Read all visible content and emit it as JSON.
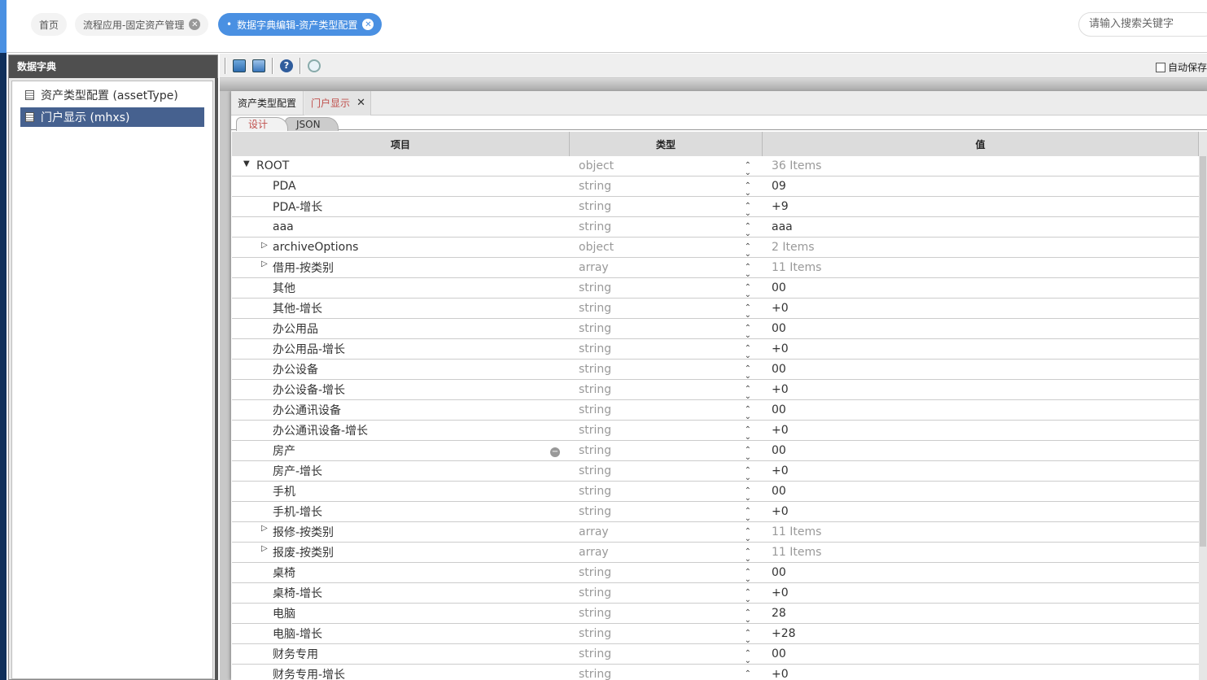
{
  "topbar": {
    "tabs": [
      {
        "label": "首页",
        "closable": false
      },
      {
        "label": "流程应用-固定资产管理",
        "closable": true
      },
      {
        "label": "数据字典编辑-资产类型配置",
        "closable": true,
        "active": true
      }
    ],
    "search_placeholder": "请输入搜索关键字"
  },
  "sidebar": {
    "title": "数据字典",
    "items": [
      {
        "label": "资产类型配置 (assetType)"
      },
      {
        "label": "门户显示 (mhxs)",
        "selected": true
      }
    ]
  },
  "toolbar": {
    "icons": [
      "save-icon",
      "save-as-icon",
      "help-icon",
      "search-icon"
    ],
    "autosave_label": "自动保存"
  },
  "doc_tabs": [
    {
      "label": "资产类型配置"
    },
    {
      "label": "门户显示",
      "active": true
    }
  ],
  "sub_tabs": [
    {
      "label": "设计",
      "active": true
    },
    {
      "label": "JSON"
    }
  ],
  "grid": {
    "headers": [
      "项目",
      "类型",
      "值"
    ],
    "rows": [
      {
        "name": "ROOT",
        "type": "object",
        "value": "36 Items",
        "expand": "down",
        "level": 0
      },
      {
        "name": "PDA",
        "type": "string",
        "value": "09"
      },
      {
        "name": "PDA-增长",
        "type": "string",
        "value": "+9"
      },
      {
        "name": "aaa",
        "type": "string",
        "value": "aaa"
      },
      {
        "name": "archiveOptions",
        "type": "object",
        "value": "2 Items",
        "expand": "right"
      },
      {
        "name": "借用-按类别",
        "type": "array",
        "value": "11 Items",
        "expand": "right"
      },
      {
        "name": "其他",
        "type": "string",
        "value": "00"
      },
      {
        "name": "其他-增长",
        "type": "string",
        "value": "+0"
      },
      {
        "name": "办公用品",
        "type": "string",
        "value": "00"
      },
      {
        "name": "办公用品-增长",
        "type": "string",
        "value": "+0"
      },
      {
        "name": "办公设备",
        "type": "string",
        "value": "00"
      },
      {
        "name": "办公设备-增长",
        "type": "string",
        "value": "+0"
      },
      {
        "name": "办公通讯设备",
        "type": "string",
        "value": "00"
      },
      {
        "name": "办公通讯设备-增长",
        "type": "string",
        "value": "+0"
      },
      {
        "name": "房产",
        "type": "string",
        "value": "00",
        "hover": true
      },
      {
        "name": "房产-增长",
        "type": "string",
        "value": "+0"
      },
      {
        "name": "手机",
        "type": "string",
        "value": "00"
      },
      {
        "name": "手机-增长",
        "type": "string",
        "value": "+0"
      },
      {
        "name": "报修-按类别",
        "type": "array",
        "value": "11 Items",
        "expand": "right"
      },
      {
        "name": "报废-按类别",
        "type": "array",
        "value": "11 Items",
        "expand": "right"
      },
      {
        "name": "桌椅",
        "type": "string",
        "value": "00"
      },
      {
        "name": "桌椅-增长",
        "type": "string",
        "value": "+0"
      },
      {
        "name": "电脑",
        "type": "string",
        "value": "28"
      },
      {
        "name": "电脑-增长",
        "type": "string",
        "value": "+28"
      },
      {
        "name": "财务专用",
        "type": "string",
        "value": "00"
      },
      {
        "name": "财务专用-增长",
        "type": "string",
        "value": "+0"
      }
    ]
  }
}
